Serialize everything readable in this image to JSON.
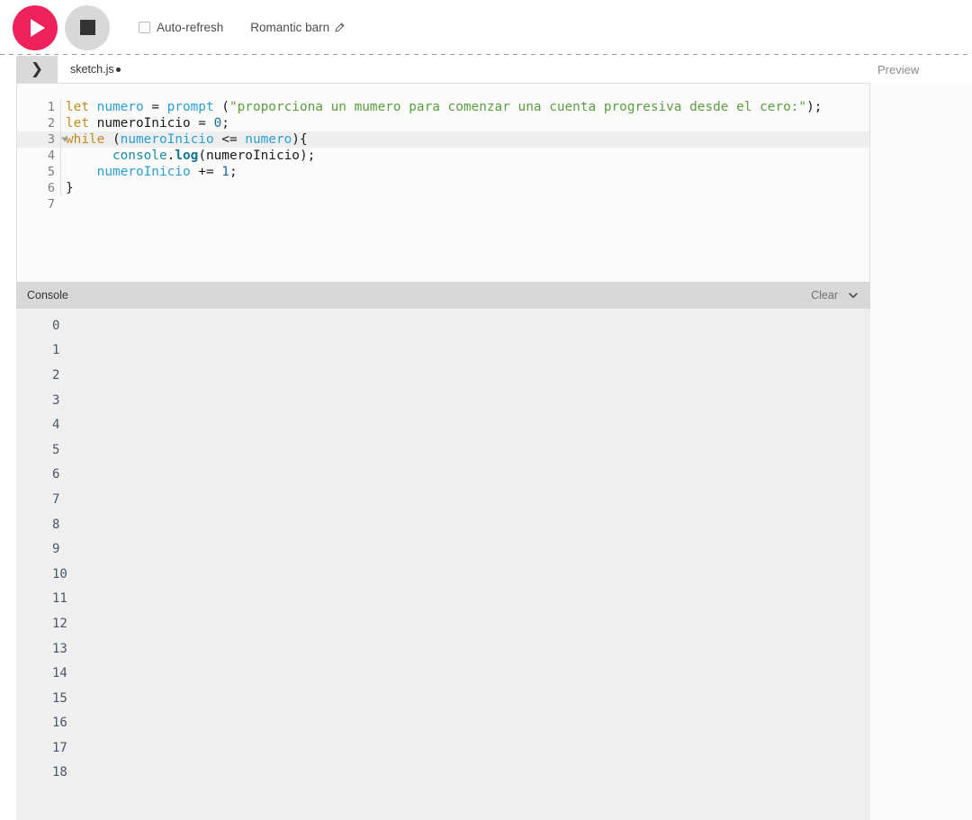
{
  "toolbar": {
    "play_button": {
      "name": "play-button",
      "label": "Play",
      "color": "#ed225d"
    },
    "stop_button": {
      "name": "stop-button",
      "label": "Stop",
      "color": "#d8d8d8"
    },
    "autorefresh": {
      "label": "Auto-refresh",
      "checked": false
    },
    "sketch_name": "Romantic barn",
    "edit_icon": "pencil-icon"
  },
  "editor": {
    "sidebar_toggle_icon": "chevron-right-icon",
    "filename": "sketch.js",
    "unsaved_indicator": "●",
    "active_line": 3,
    "lines": [
      {
        "n": "1",
        "fold": false,
        "tokens": [
          {
            "t": "let ",
            "c": "tk-kw"
          },
          {
            "t": "numero ",
            "c": "tk-var"
          },
          {
            "t": "= ",
            "c": "tk-op"
          },
          {
            "t": "prompt ",
            "c": "tk-fn"
          },
          {
            "t": "(",
            "c": "tk-plain"
          },
          {
            "t": "\"proporciona un mumero para comenzar una cuenta progresiva desde el cero:\"",
            "c": "tk-str"
          },
          {
            "t": ");",
            "c": "tk-plain"
          }
        ]
      },
      {
        "n": "2",
        "fold": false,
        "tokens": [
          {
            "t": "let ",
            "c": "tk-kw"
          },
          {
            "t": "numeroInicio ",
            "c": "tk-plain"
          },
          {
            "t": "= ",
            "c": "tk-op"
          },
          {
            "t": "0",
            "c": "tk-num"
          },
          {
            "t": ";",
            "c": "tk-plain"
          }
        ]
      },
      {
        "n": "3",
        "fold": true,
        "tokens": [
          {
            "t": "while ",
            "c": "tk-kw"
          },
          {
            "t": "(",
            "c": "tk-plain"
          },
          {
            "t": "numeroInicio ",
            "c": "tk-var"
          },
          {
            "t": "<= ",
            "c": "tk-op"
          },
          {
            "t": "numero",
            "c": "tk-var"
          },
          {
            "t": "){",
            "c": "tk-plain"
          }
        ]
      },
      {
        "n": "4",
        "fold": false,
        "tokens": [
          {
            "t": "      ",
            "c": "tk-plain"
          },
          {
            "t": "console",
            "c": "tk-obj"
          },
          {
            "t": ".",
            "c": "tk-plain"
          },
          {
            "t": "log",
            "c": "tk-prop"
          },
          {
            "t": "(numeroInicio);",
            "c": "tk-plain"
          }
        ]
      },
      {
        "n": "5",
        "fold": false,
        "tokens": [
          {
            "t": "    ",
            "c": "tk-plain"
          },
          {
            "t": "numeroInicio ",
            "c": "tk-var"
          },
          {
            "t": "+= ",
            "c": "tk-op"
          },
          {
            "t": "1",
            "c": "tk-num"
          },
          {
            "t": ";",
            "c": "tk-plain"
          }
        ]
      },
      {
        "n": "6",
        "fold": false,
        "tokens": [
          {
            "t": "}",
            "c": "tk-plain"
          }
        ]
      },
      {
        "n": "7",
        "fold": false,
        "tokens": [
          {
            "t": "",
            "c": "tk-plain"
          }
        ]
      }
    ]
  },
  "console": {
    "title": "Console",
    "clear_label": "Clear",
    "collapse_icon": "chevron-down-icon",
    "output": [
      "0",
      "1",
      "2",
      "3",
      "4",
      "5",
      "6",
      "7",
      "8",
      "9",
      "10",
      "11",
      "12",
      "13",
      "14",
      "15",
      "16",
      "17",
      "18"
    ]
  },
  "preview": {
    "label": "Preview"
  }
}
